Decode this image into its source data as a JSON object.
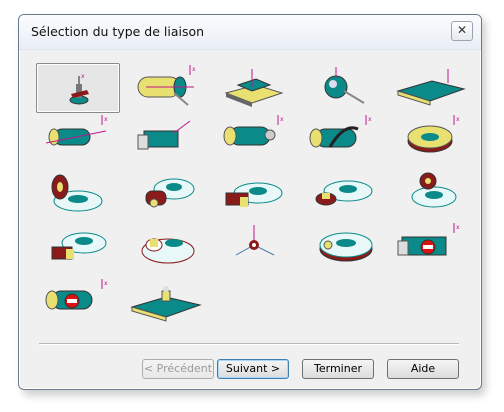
{
  "dialog": {
    "title": "Sélection du type de liaison",
    "close_label": "✕"
  },
  "link_types": [
    {
      "icon": "pivot-icon",
      "selected": true
    },
    {
      "icon": "pivot-glissant-icon",
      "selected": false
    },
    {
      "icon": "appui-plan-icon",
      "selected": false
    },
    {
      "icon": "rotule-icon",
      "selected": false
    },
    {
      "icon": "glissiere-icon",
      "selected": false
    },
    {
      "icon": "helicoidale-icon",
      "selected": false
    },
    {
      "icon": "encastrement-icon",
      "selected": false
    },
    {
      "icon": "sphere-cylindre-icon",
      "selected": false
    },
    {
      "icon": "courroie-icon",
      "selected": false
    },
    {
      "icon": "engrenage-droit-icon",
      "selected": false
    },
    {
      "icon": "engrenage-conique-icon",
      "selected": false
    },
    {
      "icon": "roue-vis-icon",
      "selected": false
    },
    {
      "icon": "pignon-cremaillere-icon",
      "selected": false
    },
    {
      "icon": "train-epicycloidal-icon",
      "selected": false
    },
    {
      "icon": "roue-libre-icon",
      "selected": false
    },
    {
      "icon": "contact-bloc-anneau-icon",
      "selected": false
    },
    {
      "icon": "came-icon",
      "selected": false
    },
    {
      "icon": "liaison-generale-icon",
      "selected": false
    },
    {
      "icon": "anneau-came-icon",
      "selected": false
    },
    {
      "icon": "blocage-glissiere-icon",
      "selected": false
    },
    {
      "icon": "blocage-pivot-icon",
      "selected": false
    },
    {
      "icon": "plaque-ponctuelle-icon",
      "selected": false
    }
  ],
  "buttons": {
    "previous": "< Précédent",
    "next": "Suivant >",
    "finish": "Terminer",
    "help": "Aide"
  },
  "colors": {
    "teal": "#0b8a8a",
    "dark_red": "#8b1a1a",
    "yellow": "#e8e070",
    "magenta": "#c0168c",
    "selection": "#e6e6e6"
  }
}
